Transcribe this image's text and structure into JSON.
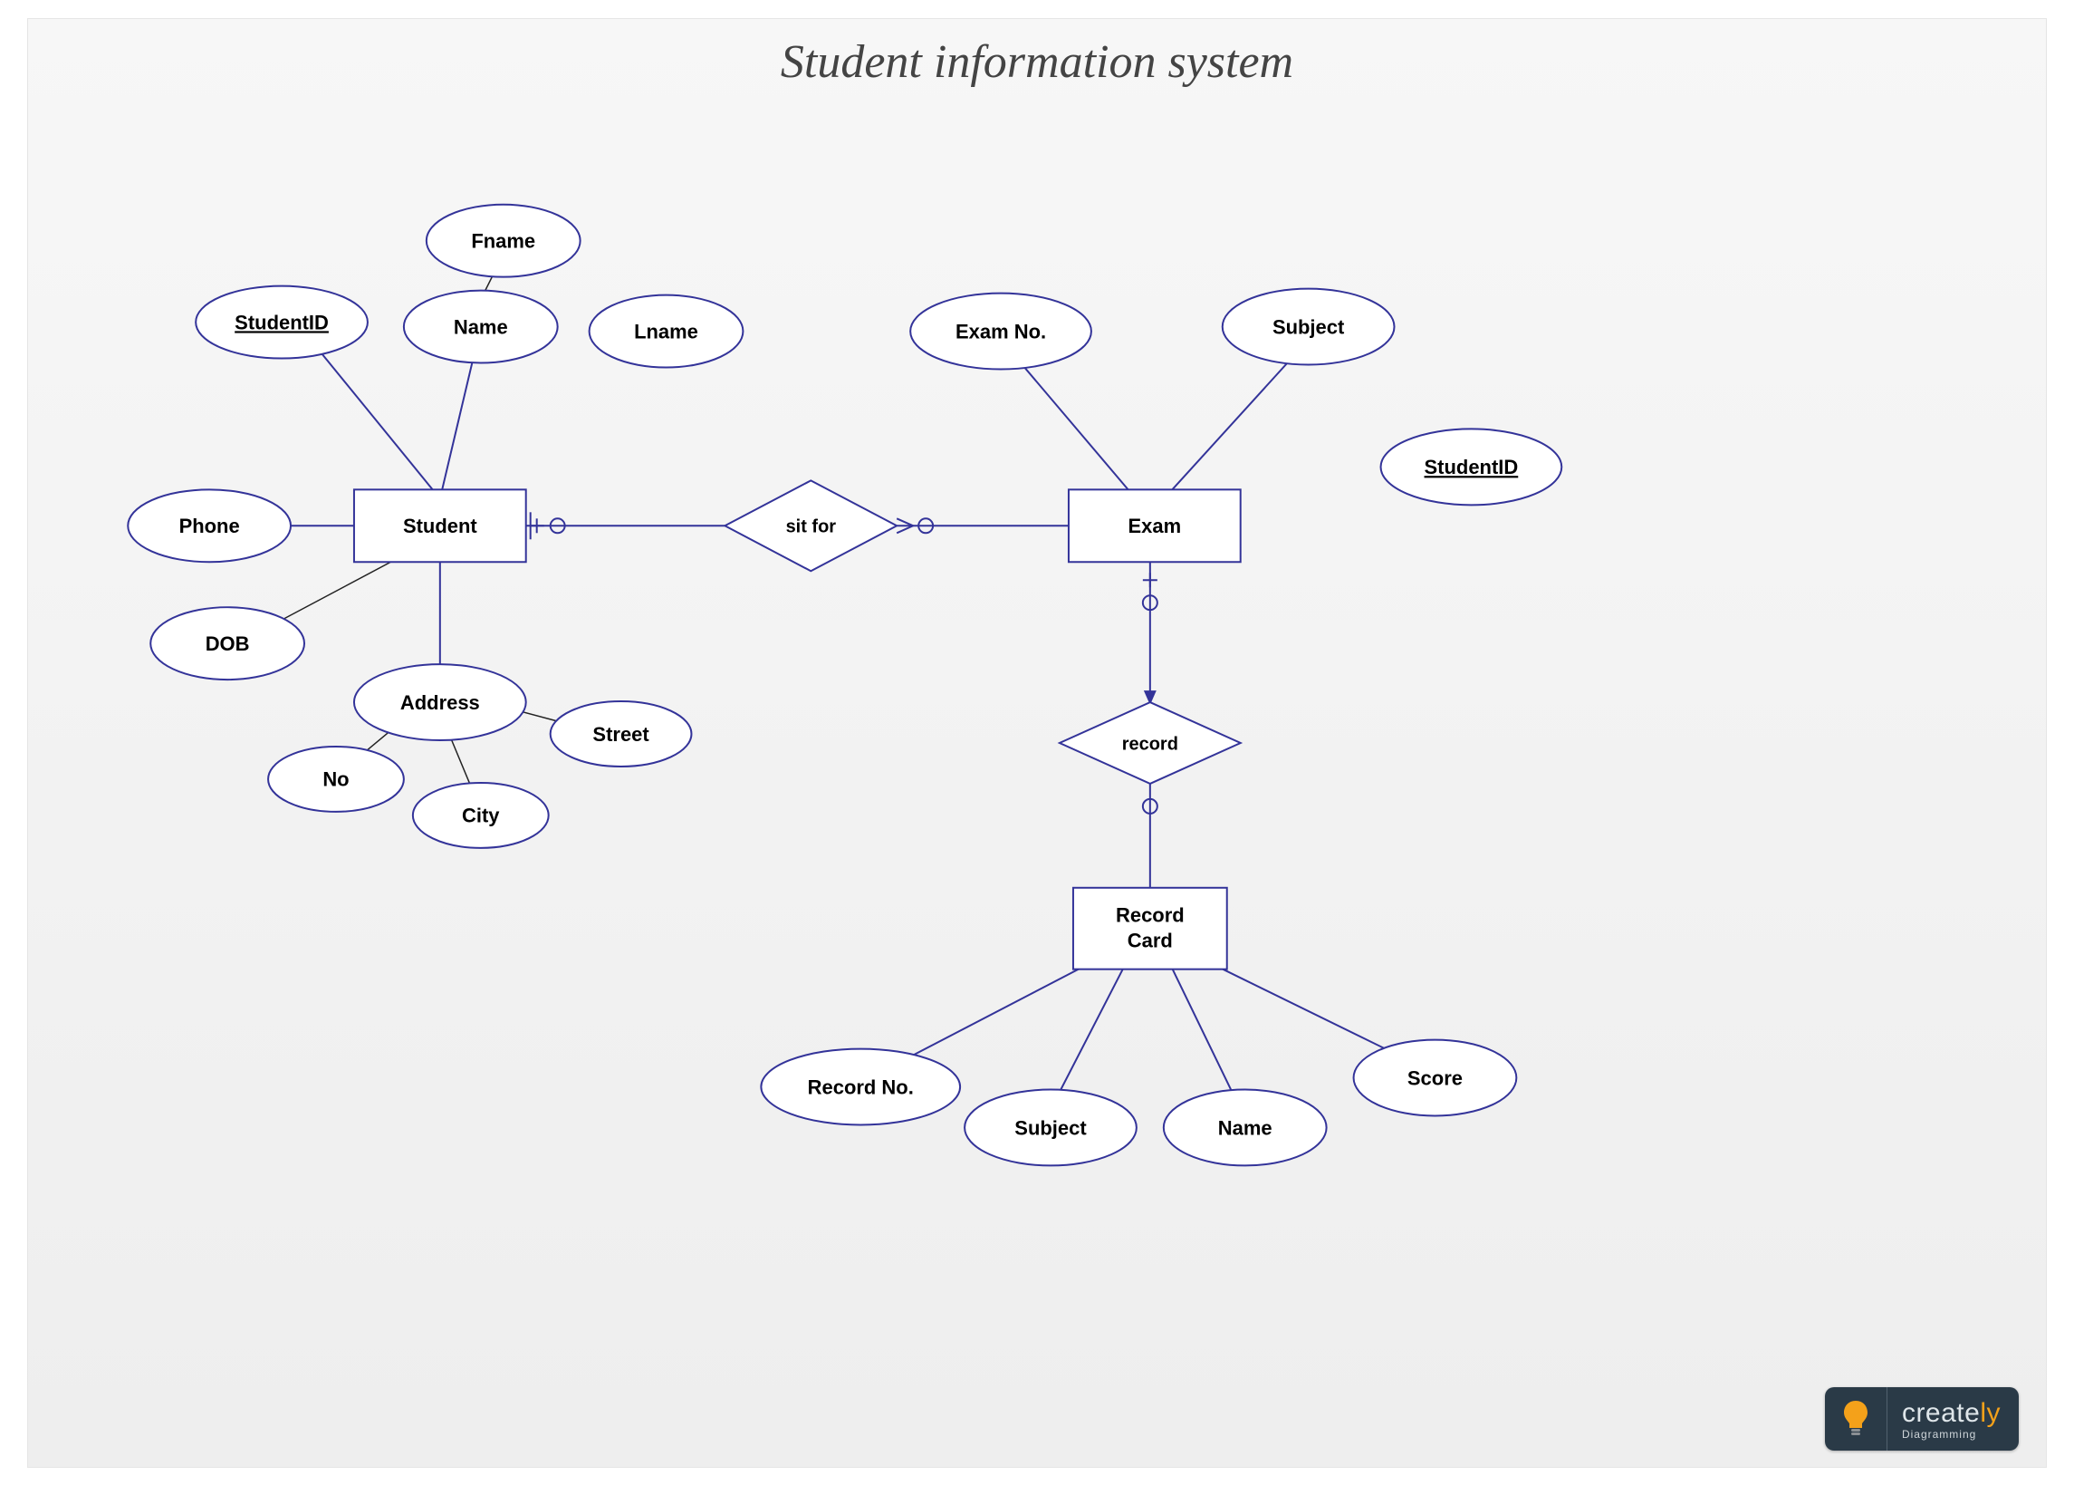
{
  "title": "Student information system",
  "entities": {
    "student": "Student",
    "exam": "Exam",
    "recordcard_l1": "Record",
    "recordcard_l2": "Card"
  },
  "relationships": {
    "sitfor": "sit for",
    "record": "record"
  },
  "attributes": {
    "studentid": "StudentID",
    "phone": "Phone",
    "dob": "DOB",
    "name": "Name",
    "fname": "Fname",
    "lname": "Lname",
    "address": "Address",
    "no": "No",
    "city": "City",
    "street": "Street",
    "examno": "Exam No.",
    "subject_exam": "Subject",
    "studentid_exam": "StudentID",
    "recordno": "Record No.",
    "subject_rc": "Subject",
    "name_rc": "Name",
    "score": "Score"
  },
  "logo": {
    "brand_left": "create",
    "brand_right": "ly",
    "sub": "Diagramming"
  }
}
